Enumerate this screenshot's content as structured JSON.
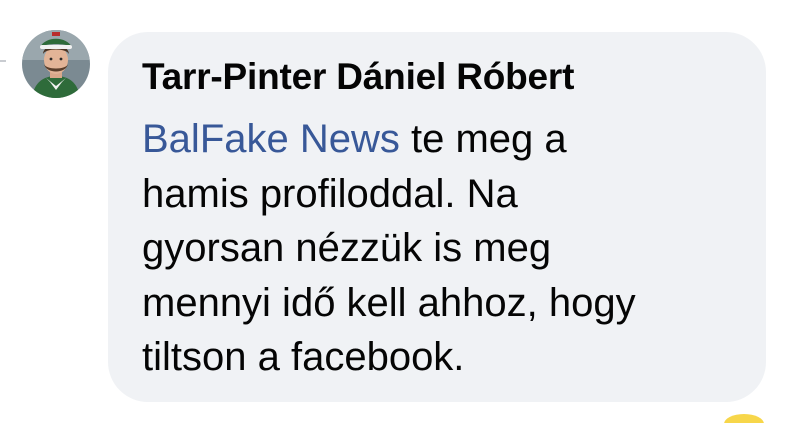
{
  "comment": {
    "author": "Tarr-Pinter Dániel Róbert",
    "mention": "BalFake News",
    "lines": [
      " te meg a",
      "hamis profiloddal. Na",
      "gyorsan nézzük is meg",
      "mennyi idő kell ahhoz, hogy",
      "tiltson a facebook."
    ]
  },
  "colors": {
    "bubble_background": "#f0f2f5",
    "text": "#050505",
    "mention_link": "#385898",
    "reaction_emoji": "#f7d64a"
  },
  "icons": {
    "avatar": "profile-photo",
    "reaction": "emoji-reaction-icon"
  }
}
